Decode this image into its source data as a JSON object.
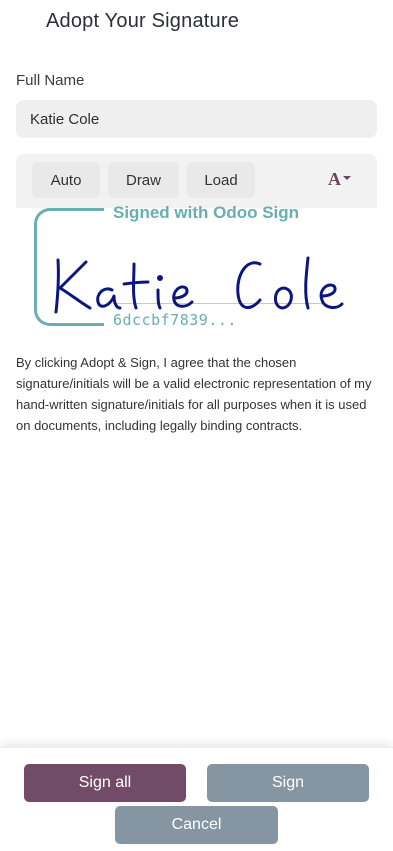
{
  "dialog": {
    "title": "Adopt Your Signature"
  },
  "form": {
    "full_name_label": "Full Name",
    "full_name_value": "Katie Cole"
  },
  "toolbar": {
    "modes": [
      "Auto",
      "Draw",
      "Load"
    ],
    "font_picker_glyph": "A",
    "font_picker_icon": "font-selector-icon"
  },
  "signature": {
    "signed_with": "Signed with Odoo Sign",
    "handwritten_name": "Katie Cole",
    "hash": "6dccbf7839...",
    "frame_color": "#69aeb1",
    "ink_color": "#0c1680"
  },
  "legal_text": "By clicking Adopt & Sign, I agree that the chosen signature/initials will be a valid electronic representation of my hand-written signature/initials for all purposes when it is used on documents, including legally binding contracts.",
  "footer": {
    "sign_all_label": "Sign all",
    "sign_label": "Sign",
    "cancel_label": "Cancel"
  },
  "colors": {
    "primary": "#714b67",
    "secondary": "#8595a2"
  }
}
